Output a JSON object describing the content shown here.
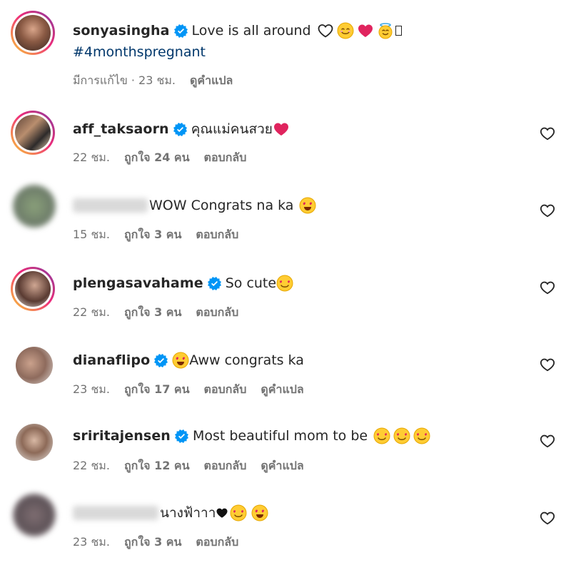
{
  "post": {
    "username": "sonyasingha",
    "caption": "Love is all around",
    "hashtag": "#4monthspregnant",
    "edited": "มีการแก้ไข · 23 ชม.",
    "translate": "ดูคำแปล"
  },
  "comments": [
    {
      "username": "aff_taksaorn",
      "text": "คุณแม่คนสวย",
      "time": "22 ชม.",
      "likes": "ถูกใจ 24 คน",
      "reply": "ตอบกลับ"
    },
    {
      "username": "",
      "text": "WOW Congrats na ka",
      "time": "15 ชม.",
      "likes": "ถูกใจ 3 คน",
      "reply": "ตอบกลับ"
    },
    {
      "username": "plengasavahame",
      "text": "So cute",
      "time": "22 ชม.",
      "likes": "ถูกใจ 3 คน",
      "reply": "ตอบกลับ"
    },
    {
      "username": "dianaflipo",
      "text": "Aww congrats ka",
      "time": "23 ชม.",
      "likes": "ถูกใจ 17 คน",
      "reply": "ตอบกลับ",
      "translate": "ดูคำแปล"
    },
    {
      "username": "sriritajensen",
      "text": "Most beautiful mom to be",
      "time": "22 ชม.",
      "likes": "ถูกใจ 12 คน",
      "reply": "ตอบกลับ",
      "translate": "ดูคำแปล"
    },
    {
      "username": "",
      "text": "นางฟ้าาา",
      "time": "23 ชม.",
      "likes": "ถูกใจ 3 คน",
      "reply": "ตอบกลับ"
    }
  ],
  "colors": {
    "verified": "#0095f6",
    "link": "#00376b",
    "meta": "#737373",
    "heart": "#e0245e"
  }
}
